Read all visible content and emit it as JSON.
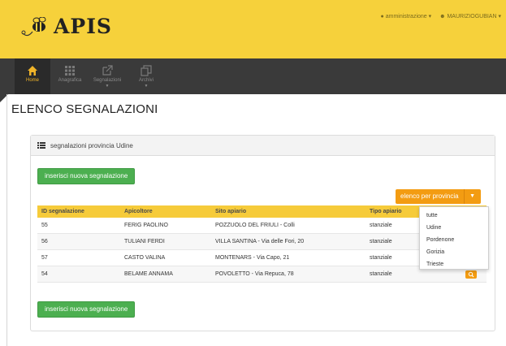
{
  "app": {
    "logo_text": "APIS",
    "user_menu": [
      "amministrazione",
      "MAURIZIOGUBIAN"
    ]
  },
  "nav": {
    "items": [
      {
        "label": "Home",
        "icon": "home-icon",
        "active": true
      },
      {
        "label": "Anagrafica",
        "icon": "grid-icon",
        "active": false
      },
      {
        "label": "Segnalazioni",
        "icon": "external-link-icon",
        "active": false
      },
      {
        "label": "Archivi",
        "icon": "copy-icon",
        "active": false
      }
    ]
  },
  "page": {
    "title": "ELENCO SEGNALAZIONI"
  },
  "panel": {
    "heading": "segnalazioni provincia Udine",
    "new_button": "inserisci nuova segnalazione",
    "bottom_button": "inserisci nuova segnalazione",
    "filter_button": "elenco per provincia"
  },
  "table": {
    "columns": [
      "ID segnalazione",
      "Apicoltore",
      "Sito apiario",
      "Tipo apiario",
      ""
    ],
    "rows": [
      {
        "id": "55",
        "apicoltore": "FERIG PAOLINO",
        "sito": "POZZUOLO DEL FRIULI - Colli",
        "tipo": "stanziale"
      },
      {
        "id": "56",
        "apicoltore": "TULIANI FERDI",
        "sito": "VILLA SANTINA - Via delle Fori, 20",
        "tipo": "stanziale"
      },
      {
        "id": "57",
        "apicoltore": "CASTO VALINA",
        "sito": "MONTENARS - Via Capo, 21",
        "tipo": "stanziale"
      },
      {
        "id": "54",
        "apicoltore": "BELAME ANNAMA",
        "sito": "POVOLETTO - Via Repuca, 78",
        "tipo": "stanziale"
      }
    ]
  },
  "dropdown": {
    "options": [
      "tutte",
      "Udine",
      "Pordenone",
      "Gorizia",
      "Trieste"
    ]
  },
  "colors": {
    "header": "#f6d13b",
    "navbar": "#3a3a3a",
    "accent": "#f39c12",
    "green": "#4caf50"
  }
}
